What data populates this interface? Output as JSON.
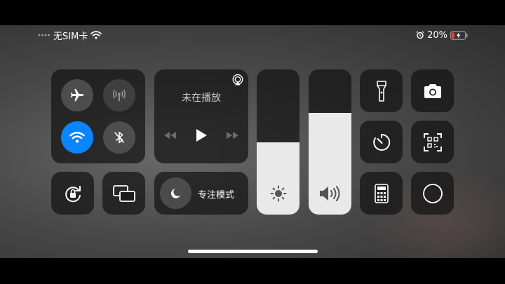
{
  "status_bar": {
    "carrier": "无SIM卡",
    "battery_percent": "20%",
    "battery_level": 0.2,
    "icons_left": [
      "signal-dots-icon",
      "wifi-icon"
    ],
    "icons_right": [
      "alarm-icon",
      "battery-charging-icon"
    ]
  },
  "connectivity": {
    "airplane": {
      "icon": "airplane-icon",
      "on": false
    },
    "cellular": {
      "icon": "cellular-antenna-icon",
      "on": false
    },
    "wifi": {
      "icon": "wifi-icon",
      "on": true
    },
    "bluetooth": {
      "icon": "bluetooth-off-icon",
      "on": false
    }
  },
  "media": {
    "title": "未在播放",
    "airplay_icon": "airplay-audio-icon",
    "controls": [
      "rewind-icon",
      "play-icon",
      "fast-forward-icon"
    ]
  },
  "focus": {
    "label": "专注模式",
    "icon": "moon-icon"
  },
  "brightness": {
    "level": 0.5,
    "icon": "sun-icon"
  },
  "volume": {
    "level": 0.7,
    "icon": "speaker-icon"
  },
  "toggles": [
    {
      "name": "flashlight",
      "icon": "flashlight-icon"
    },
    {
      "name": "camera",
      "icon": "camera-icon"
    },
    {
      "name": "timer",
      "icon": "timer-icon"
    },
    {
      "name": "qr-scanner",
      "icon": "qr-scanner-icon"
    },
    {
      "name": "calculator",
      "icon": "calculator-icon"
    },
    {
      "name": "screen-record",
      "icon": "record-circle-icon"
    },
    {
      "name": "orientation-lock",
      "icon": "orientation-lock-icon"
    },
    {
      "name": "screen-mirroring",
      "icon": "screen-mirroring-icon"
    }
  ],
  "colors": {
    "accent_blue": "#0a84ff",
    "battery_low": "#ff3b30"
  }
}
